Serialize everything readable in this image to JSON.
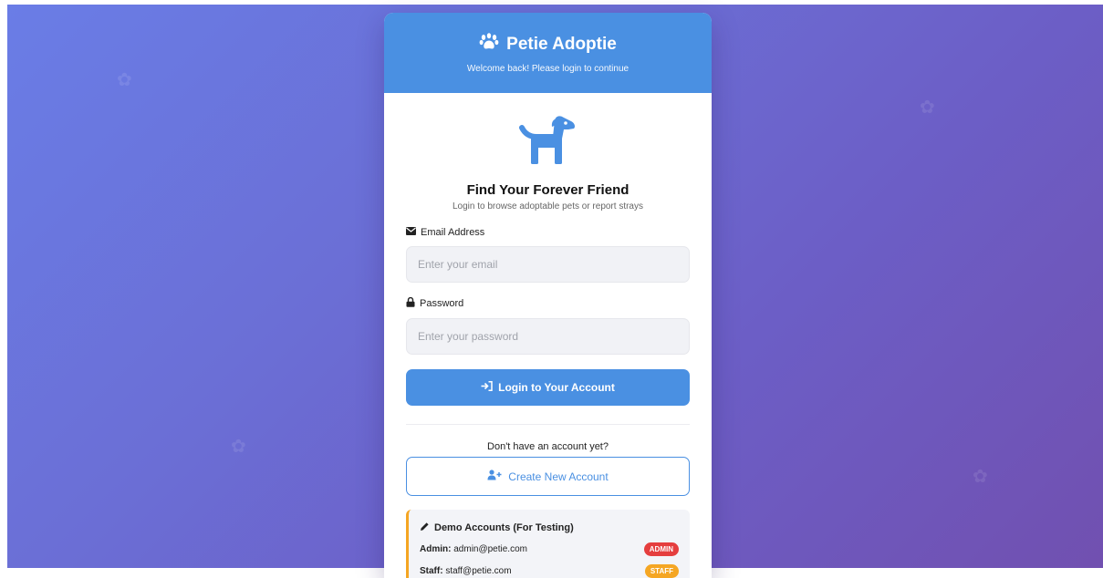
{
  "app": {
    "title": "Petie Adoptie",
    "subtitle": "Welcome back! Please login to continue"
  },
  "hero": {
    "title": "Find Your Forever Friend",
    "subtitle": "Login to browse adoptable pets or report strays"
  },
  "form": {
    "email_label": "Email Address",
    "email_placeholder": "Enter your email",
    "password_label": "Password",
    "password_placeholder": "Enter your password",
    "login_button": "Login to Your Account"
  },
  "signup": {
    "prompt": "Don't have an account yet?",
    "button": "Create New Account"
  },
  "demo": {
    "title": "Demo Accounts (For Testing)",
    "accounts": [
      {
        "role_label": "Admin:",
        "email": "admin@petie.com",
        "badge": "ADMIN",
        "badge_color": "#e53e3e"
      },
      {
        "role_label": "Staff:",
        "email": "staff@petie.com",
        "badge": "STAFF",
        "badge_color": "#f5a623"
      }
    ]
  },
  "colors": {
    "primary": "#4a90e2",
    "background_start": "#6a7de6",
    "background_end": "#7150b0",
    "demo_accent": "#f5a623"
  },
  "icons": [
    "paw-icon",
    "dog-icon",
    "envelope-icon",
    "lock-icon",
    "sign-in-icon",
    "user-plus-icon",
    "pencil-icon"
  ]
}
